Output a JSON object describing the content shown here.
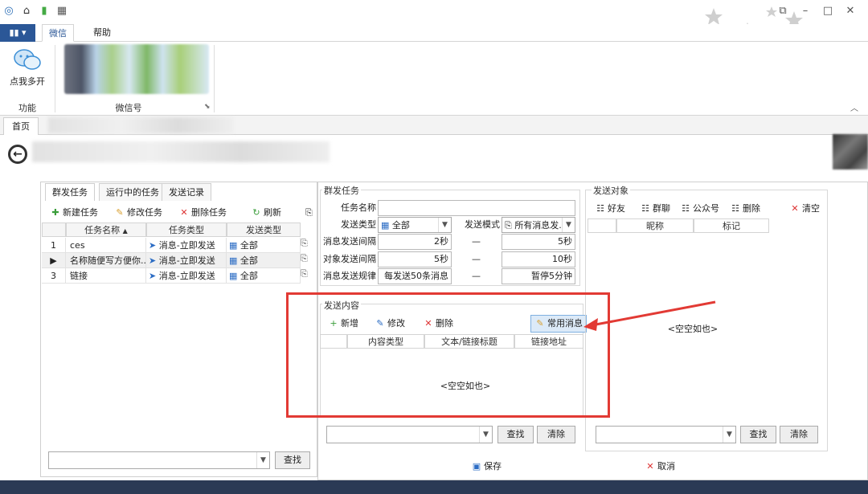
{
  "ribbon": {
    "file_label": "▮▮ ▾",
    "tabs": [
      "微信",
      "帮助"
    ],
    "wechat_multi_label": "点我多开",
    "group_function": "功能",
    "group_wechat_accounts": "微信号"
  },
  "doc_tabs": {
    "home": "首页"
  },
  "left": {
    "tabs": [
      "群发任务",
      "运行中的任务",
      "发送记录"
    ],
    "toolbar": {
      "new": "新建任务",
      "edit": "修改任务",
      "delete": "删除任务",
      "refresh": "刷新"
    },
    "columns": [
      "任务名称",
      "任务类型",
      "发送类型"
    ],
    "rows": [
      {
        "no": "1",
        "name": "ces",
        "type": "消息-立即发送",
        "send_type": "全部",
        "marker": ""
      },
      {
        "no": "",
        "name": "名称随便写方便你...",
        "type": "消息-立即发送",
        "send_type": "全部",
        "marker": "▶"
      },
      {
        "no": "3",
        "name": "链接",
        "type": "消息-立即发送",
        "send_type": "全部",
        "marker": ""
      }
    ],
    "search_label": "查找"
  },
  "task_form": {
    "section": "群发任务",
    "task_name_label": "任务名称",
    "task_name_value": "",
    "send_type_label": "发送类型",
    "send_type_value": "全部",
    "send_mode_label": "发送模式",
    "send_mode_value": "所有消息发...",
    "msg_interval_label": "消息发送间隔",
    "msg_interval_from": "2秒",
    "msg_interval_to": "5秒",
    "target_interval_label": "对象发送间隔",
    "target_interval_from": "5秒",
    "target_interval_to": "10秒",
    "rule_label": "消息发送规律",
    "rule_from": "每发送50条消息",
    "rule_to": "暂停5分钟",
    "dash": "—"
  },
  "content": {
    "section": "发送内容",
    "toolbar": {
      "add": "新增",
      "edit": "修改",
      "delete": "删除",
      "common": "常用消息"
    },
    "columns": [
      "内容类型",
      "文本/链接标题",
      "链接地址"
    ],
    "empty": "<空空如也>",
    "search_label": "查找",
    "clear_label": "清除"
  },
  "targets": {
    "section": "发送对象",
    "toolbar": {
      "friends": "好友",
      "groups": "群聊",
      "official": "公众号",
      "delete": "删除",
      "clear": "清空"
    },
    "columns": [
      "昵称",
      "标记"
    ],
    "empty": "<空空如也>",
    "search_label": "查找",
    "clear_label": "清除"
  },
  "footer": {
    "save": "保存",
    "cancel": "取消"
  },
  "colors": {
    "accent": "#2b5797",
    "highlight": "#e23a34"
  }
}
